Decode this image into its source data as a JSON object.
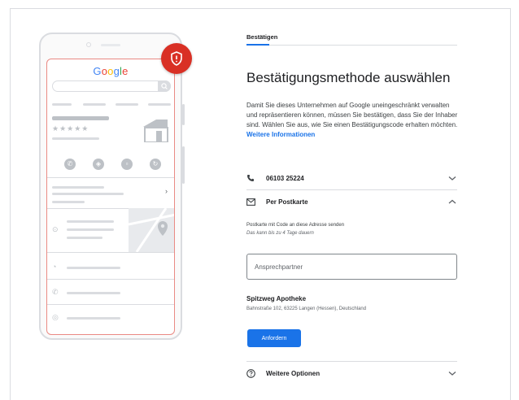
{
  "tab": {
    "label": "Bestätigen"
  },
  "title": "Bestätigungsmethode auswählen",
  "description": {
    "text": "Damit Sie dieses Unternehmen auf Google uneingeschränkt verwalten und repräsentieren können, müssen Sie bestätigen, dass Sie der Inhaber sind. Wählen Sie aus, wie Sie einen Bestätigungscode erhalten möchten. ",
    "link": "Weitere Informationen"
  },
  "phone_option": {
    "label": "06103 25224",
    "icon": "phone-icon",
    "state": "collapsed"
  },
  "postcard_option": {
    "label": "Per Postkarte",
    "icon": "mail-icon",
    "state": "expanded",
    "info": "Postkarte mit Code an diese Adresse senden",
    "duration": "Das kann bis zu 4 Tage dauern"
  },
  "contact_input": {
    "placeholder": "Ansprechpartner",
    "value": ""
  },
  "business": {
    "name": "Spitzweg Apotheke",
    "address": "Bahnstraße 102, 63225 Langen (Hessen), Deutschland"
  },
  "request_button": {
    "label": "Anfordern"
  },
  "more_options": {
    "label": "Weitere Optionen",
    "icon": "help-icon"
  },
  "illustration": {
    "logo": [
      "G",
      "o",
      "o",
      "g",
      "l",
      "e"
    ],
    "logo_colors": [
      "#4285f4",
      "#ea4335",
      "#fbbc05",
      "#4285f4",
      "#34a853",
      "#ea4335"
    ],
    "stars": "★★★★★"
  },
  "colors": {
    "accent": "#1a73e8",
    "alert": "#d93025"
  }
}
